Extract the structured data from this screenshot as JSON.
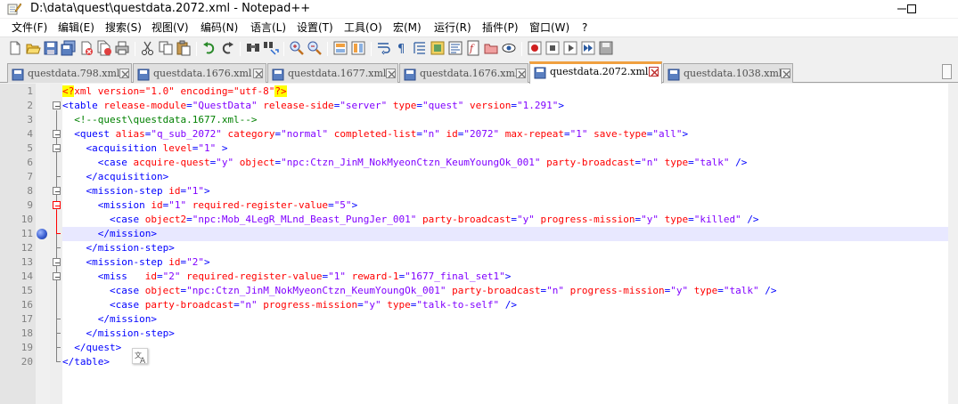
{
  "window": {
    "title": "D:\\data\\quest\\questdata.2072.xml - Notepad++",
    "app_icon": "notepad-plus-plus-icon",
    "controls": [
      "minimize-icon",
      "maximize-icon"
    ]
  },
  "menu": [
    {
      "label": "文件(F)"
    },
    {
      "label": "编辑(E)"
    },
    {
      "label": "搜索(S)"
    },
    {
      "label": "视图(V)"
    },
    {
      "label": "编码(N)"
    },
    {
      "label": "语言(L)"
    },
    {
      "label": "设置(T)"
    },
    {
      "label": "工具(O)"
    },
    {
      "label": "宏(M)"
    },
    {
      "label": "运行(R)"
    },
    {
      "label": "插件(P)"
    },
    {
      "label": "窗口(W)"
    },
    {
      "label": "?"
    }
  ],
  "toolbar": {
    "icons": [
      "new-file-icon",
      "open-file-icon",
      "save-icon",
      "save-all-icon",
      "close-icon",
      "close-all-icon",
      "print-icon",
      "cut-icon",
      "copy-icon",
      "paste-icon",
      "undo-icon",
      "redo-icon",
      "find-icon",
      "replace-icon",
      "zoom-in-icon",
      "zoom-out-icon",
      "sync-vertical-icon",
      "sync-horizontal-icon",
      "word-wrap-icon",
      "show-all-chars-icon",
      "indent-guide-icon",
      "lang-define-icon",
      "doc-map-icon",
      "function-list-icon",
      "folder-workspace-icon",
      "monitoring-icon",
      "record-macro-icon",
      "stop-record-icon",
      "play-macro-icon",
      "run-macro-multiple-icon",
      "save-macro-icon"
    ]
  },
  "tabs": [
    {
      "label": "questdata.798.xml",
      "active": false
    },
    {
      "label": "questdata.1676.xml",
      "active": false
    },
    {
      "label": "questdata.1677.xml",
      "active": false
    },
    {
      "label": "questdata.1676.xml",
      "active": false
    },
    {
      "label": "questdata.2072.xml",
      "active": true
    },
    {
      "label": "questdata.1038.xml",
      "active": false
    }
  ],
  "editor": {
    "current_line": 11,
    "bookmark_line": 11,
    "lines": [
      {
        "n": "1",
        "indent": "",
        "parts": [
          [
            "pi",
            "<?"
          ],
          [
            "pitxt",
            "xml version=\"1.0\" encoding=\"utf-8\""
          ],
          [
            "pi",
            "?>"
          ]
        ]
      },
      {
        "n": "2",
        "indent": "",
        "parts": [
          [
            "br",
            "<"
          ],
          [
            "tag",
            "table"
          ],
          [
            "txt",
            " "
          ],
          [
            "attr",
            "release-module"
          ],
          [
            "br",
            "="
          ],
          [
            "val",
            "\"QuestData\""
          ],
          [
            "txt",
            " "
          ],
          [
            "attr",
            "release-side"
          ],
          [
            "br",
            "="
          ],
          [
            "val",
            "\"server\""
          ],
          [
            "txt",
            " "
          ],
          [
            "attr",
            "type"
          ],
          [
            "br",
            "="
          ],
          [
            "val",
            "\"quest\""
          ],
          [
            "txt",
            " "
          ],
          [
            "attr",
            "version"
          ],
          [
            "br",
            "="
          ],
          [
            "val",
            "\"1.291\""
          ],
          [
            "br",
            ">"
          ]
        ]
      },
      {
        "n": "3",
        "indent": "  ",
        "parts": [
          [
            "cmt",
            "<!--quest\\questdata.1677.xml-->"
          ]
        ]
      },
      {
        "n": "4",
        "indent": "  ",
        "parts": [
          [
            "br",
            "<"
          ],
          [
            "tag",
            "quest"
          ],
          [
            "txt",
            " "
          ],
          [
            "attr",
            "alias"
          ],
          [
            "br",
            "="
          ],
          [
            "val",
            "\"q_sub_2072\""
          ],
          [
            "txt",
            " "
          ],
          [
            "attr",
            "category"
          ],
          [
            "br",
            "="
          ],
          [
            "val",
            "\"normal\""
          ],
          [
            "txt",
            " "
          ],
          [
            "attr",
            "completed-list"
          ],
          [
            "br",
            "="
          ],
          [
            "val",
            "\"n\""
          ],
          [
            "txt",
            " "
          ],
          [
            "attr",
            "id"
          ],
          [
            "br",
            "="
          ],
          [
            "val",
            "\"2072\""
          ],
          [
            "txt",
            " "
          ],
          [
            "attr",
            "max-repeat"
          ],
          [
            "br",
            "="
          ],
          [
            "val",
            "\"1\""
          ],
          [
            "txt",
            " "
          ],
          [
            "attr",
            "save-type"
          ],
          [
            "br",
            "="
          ],
          [
            "val",
            "\"all\""
          ],
          [
            "br",
            ">"
          ]
        ]
      },
      {
        "n": "5",
        "indent": "    ",
        "parts": [
          [
            "br",
            "<"
          ],
          [
            "tag",
            "acquisition"
          ],
          [
            "txt",
            " "
          ],
          [
            "attr",
            "level"
          ],
          [
            "br",
            "="
          ],
          [
            "val",
            "\"1\""
          ],
          [
            "txt",
            " "
          ],
          [
            "br",
            ">"
          ]
        ]
      },
      {
        "n": "6",
        "indent": "      ",
        "parts": [
          [
            "br",
            "<"
          ],
          [
            "tag",
            "case"
          ],
          [
            "txt",
            " "
          ],
          [
            "attr",
            "acquire-quest"
          ],
          [
            "br",
            "="
          ],
          [
            "val",
            "\"y\""
          ],
          [
            "txt",
            " "
          ],
          [
            "attr",
            "object"
          ],
          [
            "br",
            "="
          ],
          [
            "val",
            "\"npc:Ctzn_JinM_NokMyeonCtzn_KeumYoungOk_001\""
          ],
          [
            "txt",
            " "
          ],
          [
            "attr",
            "party-broadcast"
          ],
          [
            "br",
            "="
          ],
          [
            "val",
            "\"n\""
          ],
          [
            "txt",
            " "
          ],
          [
            "attr",
            "type"
          ],
          [
            "br",
            "="
          ],
          [
            "val",
            "\"talk\""
          ],
          [
            "txt",
            " "
          ],
          [
            "br",
            "/>"
          ]
        ]
      },
      {
        "n": "7",
        "indent": "    ",
        "parts": [
          [
            "br",
            "</"
          ],
          [
            "tag",
            "acquisition"
          ],
          [
            "br",
            ">"
          ]
        ]
      },
      {
        "n": "8",
        "indent": "    ",
        "parts": [
          [
            "br",
            "<"
          ],
          [
            "tag",
            "mission-step"
          ],
          [
            "txt",
            " "
          ],
          [
            "attr",
            "id"
          ],
          [
            "br",
            "="
          ],
          [
            "val",
            "\"1\""
          ],
          [
            "br",
            ">"
          ]
        ]
      },
      {
        "n": "9",
        "indent": "      ",
        "parts": [
          [
            "br",
            "<"
          ],
          [
            "tag",
            "mission"
          ],
          [
            "txt",
            " "
          ],
          [
            "attr",
            "id"
          ],
          [
            "br",
            "="
          ],
          [
            "val",
            "\"1\""
          ],
          [
            "txt",
            " "
          ],
          [
            "attr",
            "required-register-value"
          ],
          [
            "br",
            "="
          ],
          [
            "val",
            "\"5\""
          ],
          [
            "br",
            ">"
          ]
        ]
      },
      {
        "n": "10",
        "indent": "        ",
        "parts": [
          [
            "br",
            "<"
          ],
          [
            "tag",
            "case"
          ],
          [
            "txt",
            " "
          ],
          [
            "attr",
            "object2"
          ],
          [
            "br",
            "="
          ],
          [
            "val",
            "\"npc:Mob_4LegR_MLnd_Beast_PungJer_001\""
          ],
          [
            "txt",
            " "
          ],
          [
            "attr",
            "party-broadcast"
          ],
          [
            "br",
            "="
          ],
          [
            "val",
            "\"y\""
          ],
          [
            "txt",
            " "
          ],
          [
            "attr",
            "progress-mission"
          ],
          [
            "br",
            "="
          ],
          [
            "val",
            "\"y\""
          ],
          [
            "txt",
            " "
          ],
          [
            "attr",
            "type"
          ],
          [
            "br",
            "="
          ],
          [
            "val",
            "\"killed\""
          ],
          [
            "txt",
            " "
          ],
          [
            "br",
            "/>"
          ]
        ]
      },
      {
        "n": "11",
        "indent": "      ",
        "parts": [
          [
            "br",
            "</"
          ],
          [
            "tag",
            "mission"
          ],
          [
            "br",
            ">"
          ]
        ]
      },
      {
        "n": "12",
        "indent": "    ",
        "parts": [
          [
            "br",
            "</"
          ],
          [
            "tag",
            "mission-step"
          ],
          [
            "br",
            ">"
          ]
        ]
      },
      {
        "n": "13",
        "indent": "    ",
        "parts": [
          [
            "br",
            "<"
          ],
          [
            "tag",
            "mission-step"
          ],
          [
            "txt",
            " "
          ],
          [
            "attr",
            "id"
          ],
          [
            "br",
            "="
          ],
          [
            "val",
            "\"2\""
          ],
          [
            "br",
            ">"
          ]
        ]
      },
      {
        "n": "14",
        "indent": "      ",
        "parts": [
          [
            "br",
            "<"
          ],
          [
            "tag",
            "miss"
          ],
          [
            "txt",
            "   "
          ],
          [
            "attr",
            "id"
          ],
          [
            "br",
            "="
          ],
          [
            "val",
            "\"2\""
          ],
          [
            "txt",
            " "
          ],
          [
            "attr",
            "required-register-value"
          ],
          [
            "br",
            "="
          ],
          [
            "val",
            "\"1\""
          ],
          [
            "txt",
            " "
          ],
          [
            "attr",
            "reward-1"
          ],
          [
            "br",
            "="
          ],
          [
            "val",
            "\"1677_final_set1\""
          ],
          [
            "br",
            ">"
          ]
        ]
      },
      {
        "n": "15",
        "indent": "        ",
        "parts": [
          [
            "br",
            "<"
          ],
          [
            "tag",
            "case"
          ],
          [
            "txt",
            " "
          ],
          [
            "attr",
            "object"
          ],
          [
            "br",
            "="
          ],
          [
            "val",
            "\"npc:Ctzn_JinM_NokMyeonCtzn_KeumYoungOk_001\""
          ],
          [
            "txt",
            " "
          ],
          [
            "attr",
            "party-broadcast"
          ],
          [
            "br",
            "="
          ],
          [
            "val",
            "\"n\""
          ],
          [
            "txt",
            " "
          ],
          [
            "attr",
            "progress-mission"
          ],
          [
            "br",
            "="
          ],
          [
            "val",
            "\"y\""
          ],
          [
            "txt",
            " "
          ],
          [
            "attr",
            "type"
          ],
          [
            "br",
            "="
          ],
          [
            "val",
            "\"talk\""
          ],
          [
            "txt",
            " "
          ],
          [
            "br",
            "/>"
          ]
        ]
      },
      {
        "n": "16",
        "indent": "        ",
        "parts": [
          [
            "br",
            "<"
          ],
          [
            "tag",
            "case"
          ],
          [
            "txt",
            " "
          ],
          [
            "attr",
            "party-broadcast"
          ],
          [
            "br",
            "="
          ],
          [
            "val",
            "\"n\""
          ],
          [
            "txt",
            " "
          ],
          [
            "attr",
            "progress-mission"
          ],
          [
            "br",
            "="
          ],
          [
            "val",
            "\"y\""
          ],
          [
            "txt",
            " "
          ],
          [
            "attr",
            "type"
          ],
          [
            "br",
            "="
          ],
          [
            "val",
            "\"talk-to-self\""
          ],
          [
            "txt",
            " "
          ],
          [
            "br",
            "/>"
          ]
        ]
      },
      {
        "n": "17",
        "indent": "      ",
        "parts": [
          [
            "br",
            "</"
          ],
          [
            "tag",
            "mission"
          ],
          [
            "br",
            ">"
          ]
        ]
      },
      {
        "n": "18",
        "indent": "    ",
        "parts": [
          [
            "br",
            "</"
          ],
          [
            "tag",
            "mission-step"
          ],
          [
            "br",
            ">"
          ]
        ]
      },
      {
        "n": "19",
        "indent": "  ",
        "parts": [
          [
            "br",
            "</"
          ],
          [
            "tag",
            "quest"
          ],
          [
            "br",
            ">"
          ]
        ]
      },
      {
        "n": "20",
        "indent": "",
        "parts": [
          [
            "br",
            "</"
          ],
          [
            "tag",
            "table"
          ],
          [
            "br",
            ">"
          ]
        ]
      }
    ]
  },
  "colors": {
    "tag": "#0000ff",
    "attribute": "#ff0000",
    "value": "#8000ff",
    "comment": "#008000",
    "current_line": "#e8e8ff",
    "active_tab_accent": "#f0a040"
  },
  "popup": {
    "icon": "translate-icon"
  }
}
